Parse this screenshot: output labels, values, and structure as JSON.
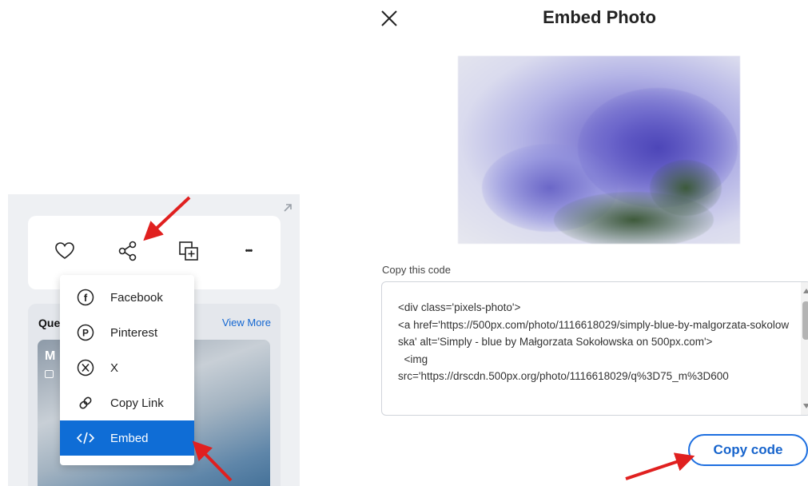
{
  "left": {
    "actions": [
      {
        "name": "like-button",
        "icon": "heart-icon"
      },
      {
        "name": "share-button",
        "icon": "share-icon"
      },
      {
        "name": "add-to-gallery-button",
        "icon": "add-to-gallery-icon"
      },
      {
        "name": "more-button",
        "icon": "more-icon"
      }
    ],
    "more_glyph": "•••",
    "share_menu": [
      {
        "label": "Facebook",
        "icon": "facebook-icon"
      },
      {
        "label": "Pinterest",
        "icon": "pinterest-icon"
      },
      {
        "label": "X",
        "icon": "x-logo-icon"
      },
      {
        "label": "Copy Link",
        "icon": "link-icon"
      },
      {
        "label": "Embed",
        "icon": "code-icon",
        "selected": true
      }
    ],
    "queue": {
      "title": "Que",
      "view_more": "View More",
      "thumb_letter": "M"
    }
  },
  "dialog": {
    "title": "Embed Photo",
    "copy_label": "Copy this code",
    "code": "<div class='pixels-photo'>\n<a href='https://500px.com/photo/1116618029/simply-blue-by-malgorzata-sokolowska' alt='Simply - blue by Małgorzata Sokołowska on 500px.com'>\n  <img\nsrc='https://drscdn.500px.org/photo/1116618029/q%3D75_m%3D600",
    "copy_button": "Copy code"
  },
  "colors": {
    "accent": "#0f6dd6",
    "arrow": "#e0201f",
    "link": "#1467d1",
    "panel_bg": "#eef0f3"
  }
}
